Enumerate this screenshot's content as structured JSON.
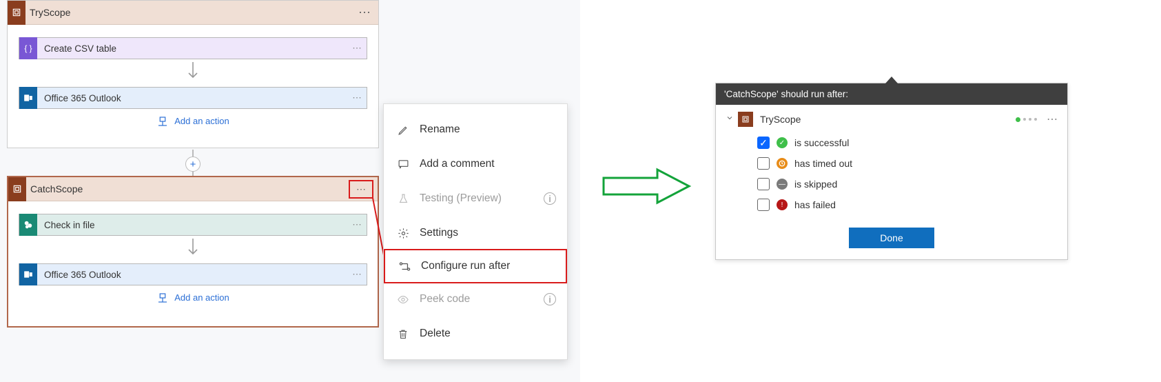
{
  "tryScope": {
    "title": "TryScope",
    "actions": {
      "csv": "Create CSV table",
      "outlook": "Office 365 Outlook"
    },
    "addAction": "Add an action"
  },
  "catchScope": {
    "title": "CatchScope",
    "actions": {
      "checkin": "Check in file",
      "outlook": "Office 365 Outlook"
    },
    "addAction": "Add an action"
  },
  "menu": {
    "rename": "Rename",
    "comment": "Add a comment",
    "testing": "Testing (Preview)",
    "settings": "Settings",
    "configure": "Configure run after",
    "peek": "Peek code",
    "delete": "Delete"
  },
  "panel": {
    "header": "'CatchScope' should run after:",
    "source": "TryScope",
    "opts": {
      "ok": "is successful",
      "timeout": "has timed out",
      "skip": "is skipped",
      "fail": "has failed"
    },
    "done": "Done"
  }
}
